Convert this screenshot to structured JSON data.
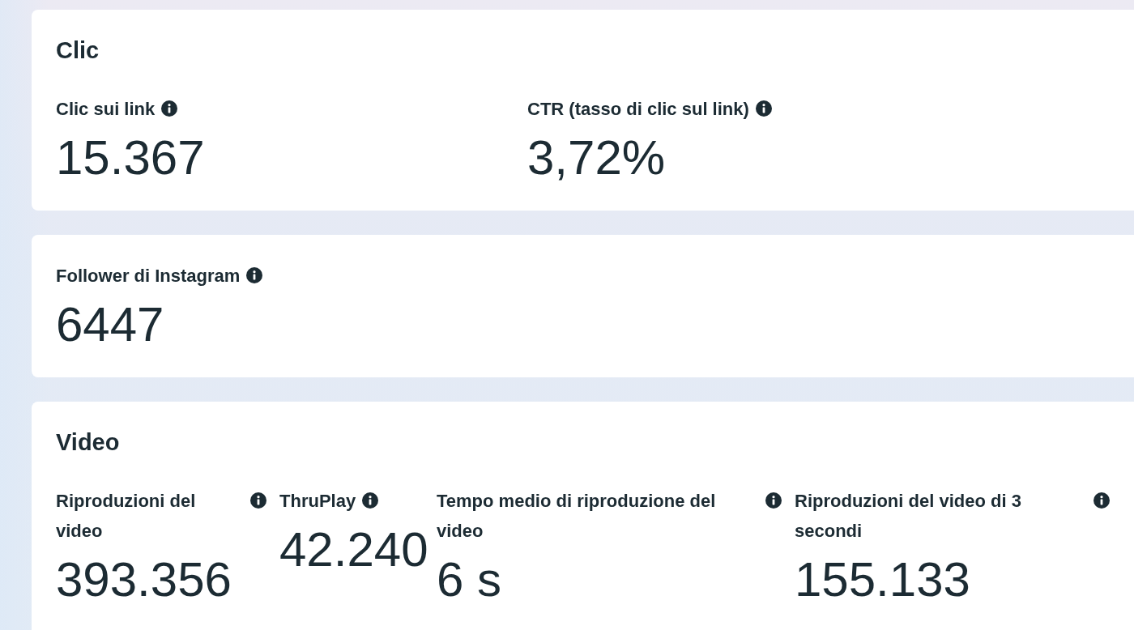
{
  "sections": [
    {
      "title": "Clic",
      "metrics": [
        {
          "label": "Clic sui link",
          "value": "15.367"
        },
        {
          "label": "CTR (tasso di clic sul link)",
          "value": "3,72%"
        }
      ]
    },
    {
      "metrics": [
        {
          "label": "Follower di Instagram",
          "value": "6447"
        }
      ]
    },
    {
      "title": "Video",
      "metrics": [
        {
          "label": "Riproduzioni del video",
          "value": "393.356"
        },
        {
          "label": "ThruPlay",
          "value": "42.240"
        },
        {
          "label": "Tempo medio di riproduzione del video",
          "value": "6 s"
        },
        {
          "label": "Riproduzioni del video di 3 secondi",
          "value": "155.133"
        }
      ]
    }
  ]
}
